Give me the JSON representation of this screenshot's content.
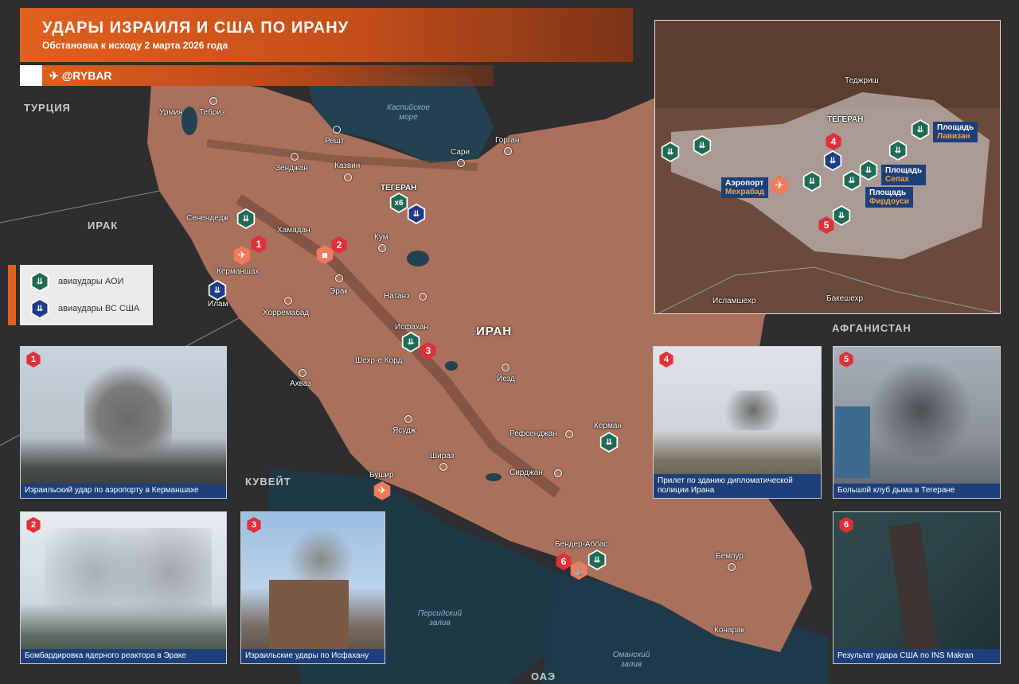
{
  "header": {
    "title": "УДАРЫ ИЗРАИЛЯ И США ПО ИРАНУ",
    "subtitle": "Обстановка к исходу 2 марта 2026 года",
    "handle": "@RYBAR"
  },
  "countries": {
    "turkey": "ТУРЦИЯ",
    "iraq": "ИРАК",
    "kuwait": "КУВЕЙТ",
    "afghanistan": "АФГАНИСТАН",
    "uae": "ОАЭ",
    "iran": "ИРАН"
  },
  "water": {
    "caspian": "Каспийское море",
    "persian_gulf": "Персидский залив",
    "oman_gulf": "Оманский залив"
  },
  "cities": {
    "urmia": "Урмия",
    "tabriz": "Тебриз",
    "rasht": "Решт",
    "sari": "Сари",
    "gorgan": "Горган",
    "zanjan": "Зенджан",
    "qazvin": "Казвин",
    "tehran": "ТЕГЕРАН",
    "sanandaj": "Сенендедж",
    "hamadan": "Хамадан",
    "qom": "Кум",
    "kermanshah": "Керманшах",
    "arak": "Эрак",
    "ilam": "Илам",
    "khorramabad": "Хорремабад",
    "natanz": "Натанз",
    "isfahan": "Исфахан",
    "shahrekord": "Шехр-е Корд",
    "yazd": "Йезд",
    "ahvaz": "Ахваз",
    "yasuj": "Ясудж",
    "rafsanjan": "Рефсенджан",
    "kerman": "Керман",
    "shiraz": "Шираз",
    "sirjan": "Сирджан",
    "bushehr": "Бушир",
    "bandar_abbas": "Бендер-Аббас",
    "bampur": "Бемпур",
    "konarak": "Конарак"
  },
  "tehran_x6": "х6",
  "legend": {
    "idf": "авиаудары АОИ",
    "us": "авиаудары ВС США"
  },
  "photos": [
    {
      "n": "1",
      "caption": "Израильский удар по аэропорту в Керманшахе"
    },
    {
      "n": "2",
      "caption": "Бомбардировка ядерного реактора в Эраке"
    },
    {
      "n": "3",
      "caption": "Израильские удары по Исфахану"
    },
    {
      "n": "4",
      "caption": "Прилет по зданию дипломатической полиции Ирана"
    },
    {
      "n": "5",
      "caption": "Большой клуб дыма в Тегеране"
    },
    {
      "n": "6",
      "caption": "Результат удара США по INS Makran"
    }
  ],
  "inset": {
    "tajrish": "Теджриш",
    "tehran": "ТЕГЕРАН",
    "eslamshahr": "Исламшехр",
    "bagershahr": "Бакешехр",
    "airport_a": "Аэропорт",
    "airport_b": "Мехрабад",
    "lavizan_a": "Площадь",
    "lavizan_b": "Лавизан",
    "sepah_a": "Площадь",
    "sepah_b": "Сепах",
    "ferdowsi_a": "Площадь",
    "ferdowsi_b": "Фирдоуси",
    "n4": "4",
    "n5": "5"
  },
  "markers": {
    "m1": "1",
    "m2": "2",
    "m3": "3",
    "m6": "6"
  },
  "colors": {
    "accent": "#e0601e",
    "idf_green": "#1f6b56",
    "us_blue": "#1e3d86",
    "strike_red": "#e0303a",
    "caption_blue": "#1d3f7a"
  }
}
